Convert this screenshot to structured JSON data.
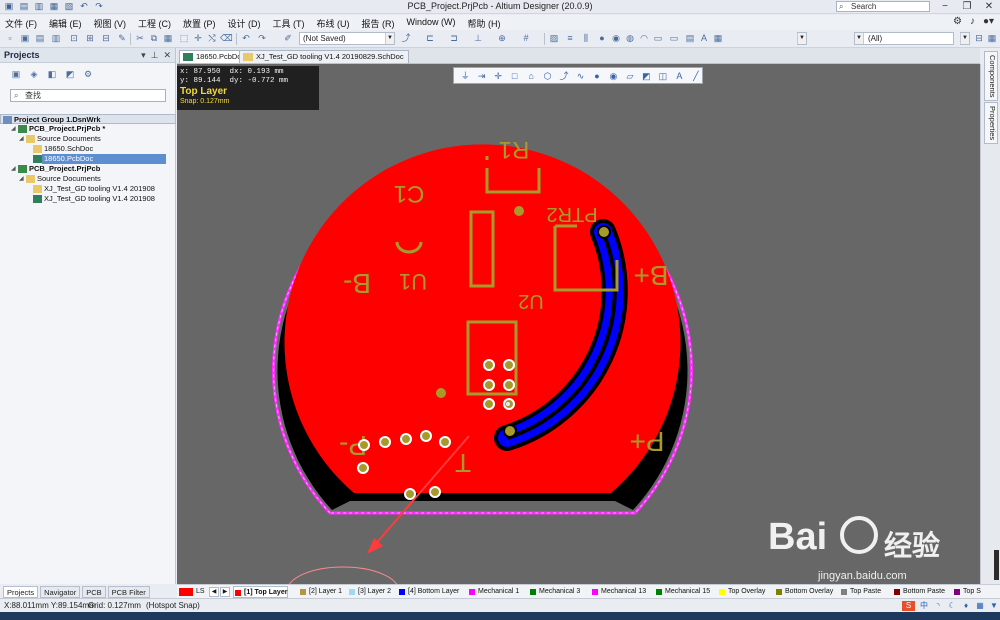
{
  "window": {
    "title": "PCB_Project.PrjPcb - Altium Designer (20.0.9)",
    "search_placeholder": "Search"
  },
  "menu": [
    "文件 (F)",
    "编辑 (E)",
    "视图 (V)",
    "工程 (C)",
    "放置 (P)",
    "设计 (D)",
    "工具 (T)",
    "布线 (U)",
    "报告 (R)",
    "Window (W)",
    "帮助 (H)"
  ],
  "toolbar": {
    "saved_state": "(Not Saved)",
    "filter_value": "(All)"
  },
  "projects_panel": {
    "title": "Projects",
    "search_placeholder": "查找",
    "tree": [
      {
        "label": "Project Group 1.DsnWrk",
        "level": 0,
        "kind": "group"
      },
      {
        "label": "PCB_Project.PrjPcb *",
        "level": 1,
        "kind": "project"
      },
      {
        "label": "Source Documents",
        "level": 2,
        "kind": "folder"
      },
      {
        "label": "18650.SchDoc",
        "level": 3,
        "kind": "sch"
      },
      {
        "label": "18650.PcbDoc",
        "level": 3,
        "kind": "pcb",
        "selected": true
      },
      {
        "label": "PCB_Project.PrjPcb",
        "level": 1,
        "kind": "project"
      },
      {
        "label": "Source Documents",
        "level": 2,
        "kind": "folder"
      },
      {
        "label": "XJ_Test_GD tooling V1.4 201908",
        "level": 3,
        "kind": "sch"
      },
      {
        "label": "XJ_Test_GD tooling V1.4 201908",
        "level": 3,
        "kind": "pcb"
      }
    ],
    "bottom_tabs": [
      "Projects",
      "Navigator",
      "PCB",
      "PCB Filter"
    ]
  },
  "doc_tabs": [
    {
      "label": "18650.PcbDoc",
      "active": true
    },
    {
      "label": "XJ_Test_GD tooling V1.4 20190829.SchDoc",
      "active": false
    }
  ],
  "hud": {
    "x": "x: 87.950",
    "dx": "dx:  0.193 mm",
    "y": "y: 89.144",
    "dy": "dy: -0.772 mm",
    "layer": "Top Layer",
    "snap": "Snap: 0.127mm"
  },
  "pcb_labels": {
    "r1": "R1",
    "c1": "C1",
    "u1": "U1",
    "u2": "U2",
    "ptr2": "PTR2",
    "b_minus": "B-",
    "b_plus": "B+",
    "p_minus": "P-",
    "p_plus": "P+",
    "t": "T"
  },
  "side_tabs": [
    "Components",
    "Properties"
  ],
  "layer_bar": {
    "ls": "LS",
    "layers": [
      {
        "label": "[1] Top Layer",
        "color": "#ff0000",
        "active": true
      },
      {
        "label": "[2] Layer 1",
        "color": "#b09840"
      },
      {
        "label": "[3] Layer 2",
        "color": "#9fd8f0"
      },
      {
        "label": "[4] Bottom Layer",
        "color": "#0000ff"
      },
      {
        "label": "Mechanical 1",
        "color": "#ff00ff"
      },
      {
        "label": "Mechanical 3",
        "color": "#008000"
      },
      {
        "label": "Mechanical 13",
        "color": "#ff00ff"
      },
      {
        "label": "Mechanical 15",
        "color": "#008000"
      },
      {
        "label": "Top Overlay",
        "color": "#ffff00"
      },
      {
        "label": "Bottom Overlay",
        "color": "#808000"
      },
      {
        "label": "Top Paste",
        "color": "#808080"
      },
      {
        "label": "Bottom Paste",
        "color": "#800000"
      },
      {
        "label": "Top S",
        "color": "#800080"
      }
    ]
  },
  "status": {
    "coords": "X:88.011mm Y:89.154mm",
    "grid": "Grid: 0.127mm",
    "snap_mode": "(Hotspot Snap)"
  },
  "watermark": {
    "brand": "Bai",
    "cn": "经验",
    "url": "jingyan.baidu.com"
  },
  "colors": {
    "top_layer": "#ff0000",
    "bottom_layer": "#0000ff",
    "silkscreen": "#a89a2a",
    "outline": "#ff00ff",
    "canvas": "#676767"
  }
}
